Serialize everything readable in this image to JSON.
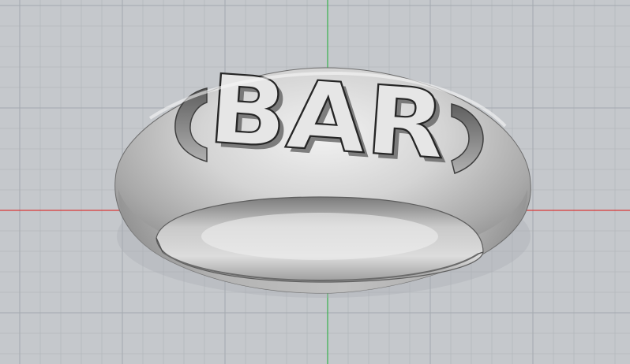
{
  "viewport": {
    "projection": "perspective",
    "background_color": "#c5c8cc",
    "grid": true,
    "grid_minor_color": "#b4b8bd",
    "grid_major_color": "#a4a9af",
    "x_axis_color": "#d93a3a",
    "y_axis_color": "#37b24d"
  },
  "model": {
    "object": "ring",
    "material_color": "#c8c8c8",
    "engraved_text": "BAR"
  }
}
